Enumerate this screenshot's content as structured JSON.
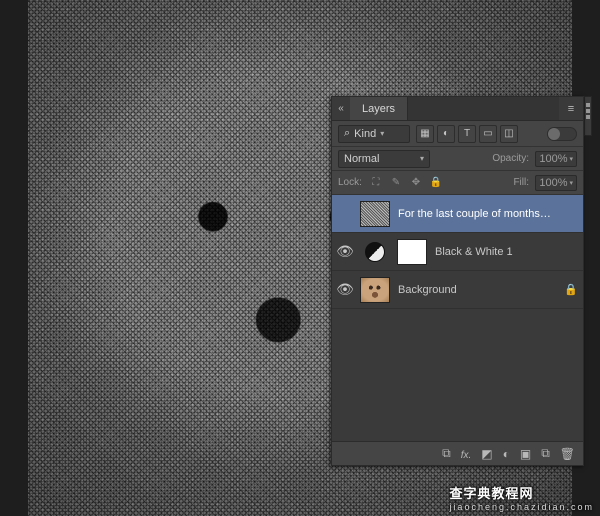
{
  "panel": {
    "title": "Layers",
    "filter": {
      "kind_label": "Kind",
      "icons": [
        "pixel",
        "adjustment",
        "type",
        "shape",
        "smartobject"
      ]
    },
    "blend": {
      "mode": "Normal",
      "opacity_label": "Opacity:",
      "opacity_value": "100%"
    },
    "lock": {
      "label": "Lock:",
      "fill_label": "Fill:",
      "fill_value": "100%"
    },
    "layers": [
      {
        "label": "For the last couple of months, Se...",
        "visible": false,
        "selected": true,
        "locked": false,
        "type": "text-rasterized"
      },
      {
        "label": "Black & White 1",
        "visible": true,
        "selected": false,
        "locked": false,
        "type": "adjustment-bw"
      },
      {
        "label": "Background",
        "visible": true,
        "selected": false,
        "locked": true,
        "type": "image"
      }
    ],
    "footer_icons": [
      "link",
      "fx",
      "mask",
      "fill-adjust",
      "group",
      "new-layer",
      "trash"
    ]
  },
  "icons": {
    "search": "⌕",
    "caret": "▾",
    "eye": "👁",
    "lock": "🔒",
    "menu": "≡",
    "close": "×",
    "link": "⧉",
    "fx": "fx.",
    "mask": "◩",
    "adjust": "◐",
    "group": "▣",
    "new": "⧉",
    "trash": "🗑",
    "pixel": "▦",
    "type": "T",
    "shape": "▭",
    "smart": "◫",
    "brush": "✎",
    "move": "✥",
    "trans_lock": "⛶"
  },
  "watermark": {
    "main": "查字典",
    "sub": "jiaocheng.chazidian.com"
  }
}
